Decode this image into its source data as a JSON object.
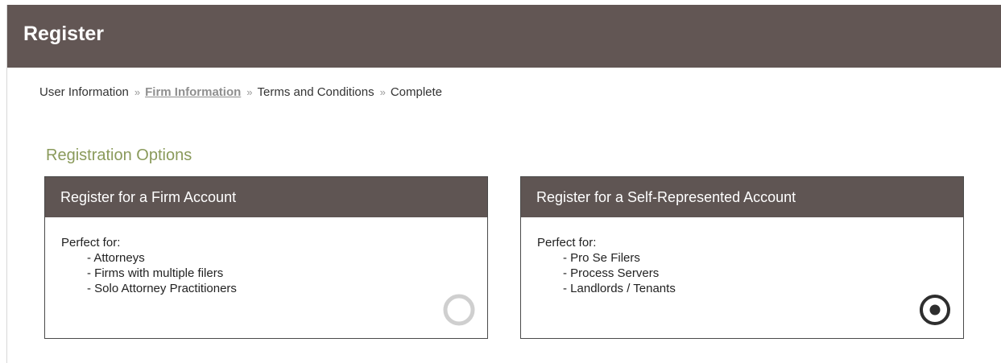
{
  "header": {
    "title": "Register"
  },
  "breadcrumb": {
    "steps": [
      "User Information",
      "Firm Information",
      "Terms and Conditions",
      "Complete"
    ],
    "separator": "»"
  },
  "options": {
    "title": "Registration Options",
    "cards": [
      {
        "title": "Register for a Firm Account",
        "intro": "Perfect for:",
        "items": [
          "Attorneys",
          "Firms with multiple filers",
          "Solo Attorney Practitioners"
        ],
        "selected": false
      },
      {
        "title": "Register for a Self-Represented Account",
        "intro": "Perfect for:",
        "items": [
          "Pro Se Filers",
          "Process Servers",
          "Landlords / Tenants"
        ],
        "selected": true
      }
    ]
  },
  "colors": {
    "header_bg": "#625654",
    "accent_title": "#8a9a5b",
    "radio_unselected": "#cfcfcf",
    "radio_selected": "#2e2e2e"
  }
}
